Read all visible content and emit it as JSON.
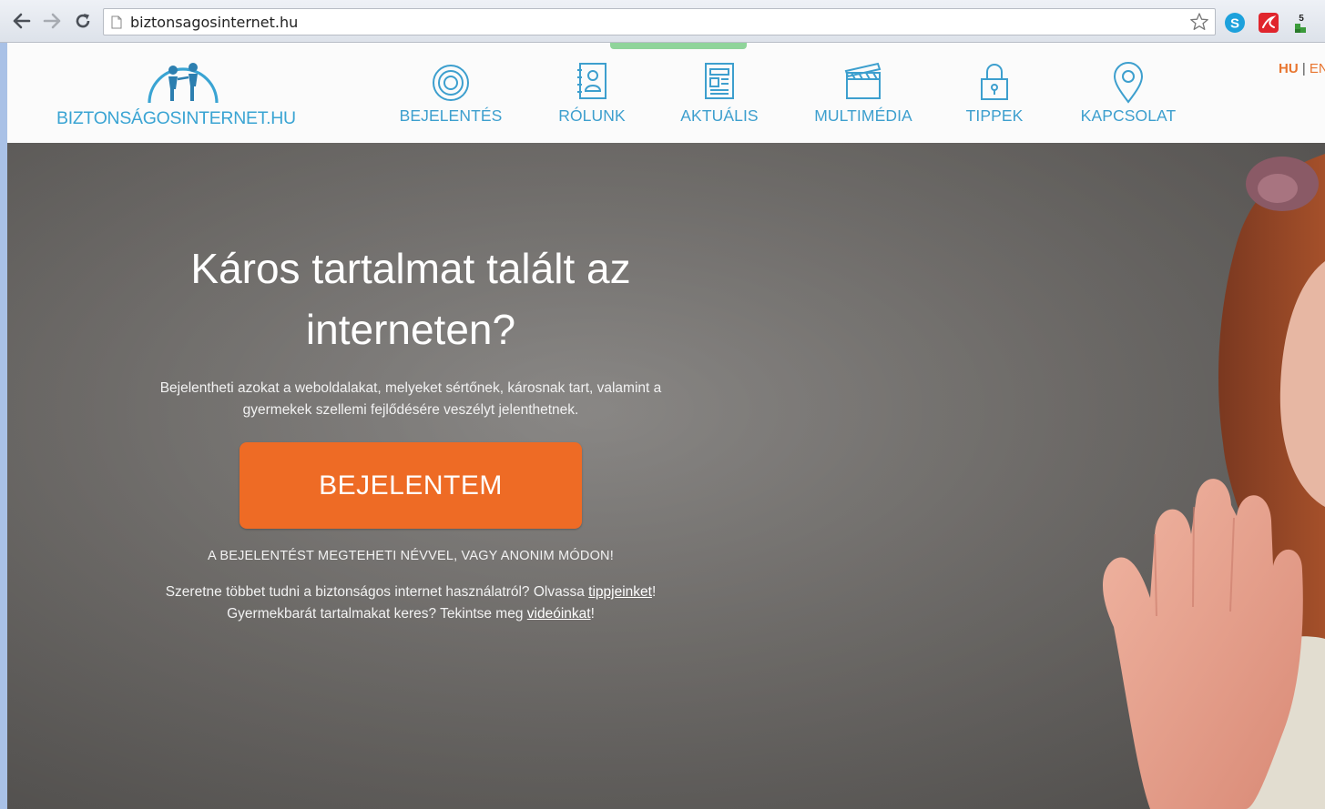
{
  "browser": {
    "url": "biztonsagosinternet.hu",
    "extensions": [
      {
        "icon": "skype-icon",
        "color": "#1da1dc"
      },
      {
        "icon": "pdf-reader-icon",
        "color": "#e0252d"
      },
      {
        "icon": "counter-icon",
        "label": "5",
        "color": "#3b9b3b"
      }
    ]
  },
  "site": {
    "logo_text": "BIZTONSÁGOSINTERNET.HU",
    "brand_color": "#3aa4d3",
    "nav": [
      {
        "label": "BEJELENTÉS",
        "icon": "target-icon"
      },
      {
        "label": "RÓLUNK",
        "icon": "contact-book-icon"
      },
      {
        "label": "AKTUÁLIS",
        "icon": "newspaper-icon"
      },
      {
        "label": "MULTIMÉDIA",
        "icon": "clapperboard-icon"
      },
      {
        "label": "TIPPEK",
        "icon": "padlock-icon"
      },
      {
        "label": "KAPCSOLAT",
        "icon": "map-pin-icon"
      }
    ],
    "lang": {
      "active": "HU",
      "separator": "|",
      "other": "EN"
    }
  },
  "hero": {
    "headline": "Káros tartalmat talált az interneten?",
    "lead": "Bejelentheti azokat a weboldalakat, melyeket sértőnek, károsnak tart, valamint a gyermekek szellemi fejlődésére veszélyt jelenthetnek.",
    "cta_label": "BEJELENTEM",
    "cta_color": "#ee6b25",
    "anon_note": "A BEJELENTÉST MEGTEHETI NÉVVEL, VAGY ANONIM MÓDON!",
    "more_line1_before": "Szeretne többet tudni a biztonságos internet használatról? Olvassa ",
    "tips_link": "tippjeinket",
    "more_line1_after": "!",
    "more_line2_before": "Gyermekbarát tartalmakat keres? Tekintse meg ",
    "videos_link": "videóinkat",
    "more_line2_after": "!"
  }
}
